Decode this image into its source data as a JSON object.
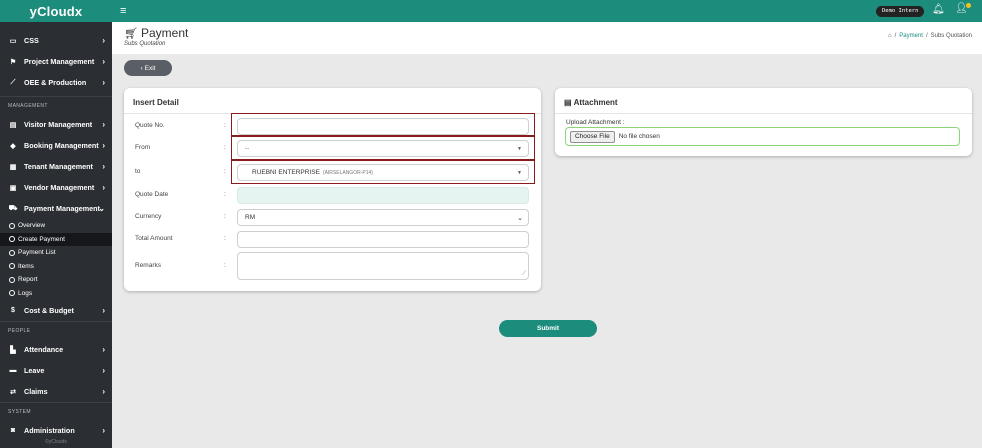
{
  "app": {
    "brand": "yCloudx",
    "footer": "©yCloudx"
  },
  "topbar": {
    "user_badge": "Demo Intern"
  },
  "sidebar": {
    "items_top": [
      {
        "label": "CSS",
        "icon": "monitor-icon"
      },
      {
        "label": "Project Management",
        "icon": "flag-icon"
      },
      {
        "label": "OEE & Production",
        "icon": "chart-line-icon"
      }
    ],
    "section_management": "MANAGEMENT",
    "items_mgmt": [
      {
        "label": "Visitor Management",
        "icon": "id-card-icon"
      },
      {
        "label": "Booking Management",
        "icon": "tag-icon"
      },
      {
        "label": "Tenant Management",
        "icon": "building-icon"
      },
      {
        "label": "Vendor Management",
        "icon": "vendor-card-icon"
      },
      {
        "label": "Payment Management",
        "icon": "cart-icon"
      }
    ],
    "payment_sub": [
      {
        "label": "Overview"
      },
      {
        "label": "Create Payment"
      },
      {
        "label": "Payment List"
      },
      {
        "label": "Items"
      },
      {
        "label": "Report"
      },
      {
        "label": "Logs"
      }
    ],
    "cost_budget": "Cost & Budget",
    "section_people": "PEOPLE",
    "items_people": [
      {
        "label": "Attendance"
      },
      {
        "label": "Leave"
      },
      {
        "label": "Claims"
      }
    ],
    "section_system": "SYSTEM",
    "administration": "Administration"
  },
  "header": {
    "title": "Payment",
    "subtitle": "Subs Quotation",
    "breadcrumb_link": "Payment",
    "breadcrumb_sep": "/",
    "breadcrumb_current": "Subs Quotation"
  },
  "exit_label": "Exit",
  "insert_detail": {
    "title": "Insert Detail",
    "colon": ":",
    "quote_no_label": "Quote No.",
    "quote_no_value": "",
    "from_label": "From",
    "from_value": "--",
    "to_label": "to",
    "to_value": "RUEBNI ENTERPRISE",
    "to_sub": "(AIRSELANGOR-P14)",
    "quote_date_label": "Quote Date",
    "quote_date_value": "",
    "currency_label": "Currency",
    "currency_value": "RM",
    "total_amount_label": "Total Amount",
    "total_amount_value": "",
    "remarks_label": "Remarks",
    "remarks_value": ""
  },
  "attachment": {
    "title": "Attachment",
    "upload_label": "Upload Attachment :",
    "choose_file": "Choose File",
    "no_file": "No file chosen"
  },
  "submit_label": "Submit",
  "colors": {
    "accent": "#1c8c7d",
    "sidebar": "#2b2e33",
    "highlight": "#8b1a1a"
  }
}
